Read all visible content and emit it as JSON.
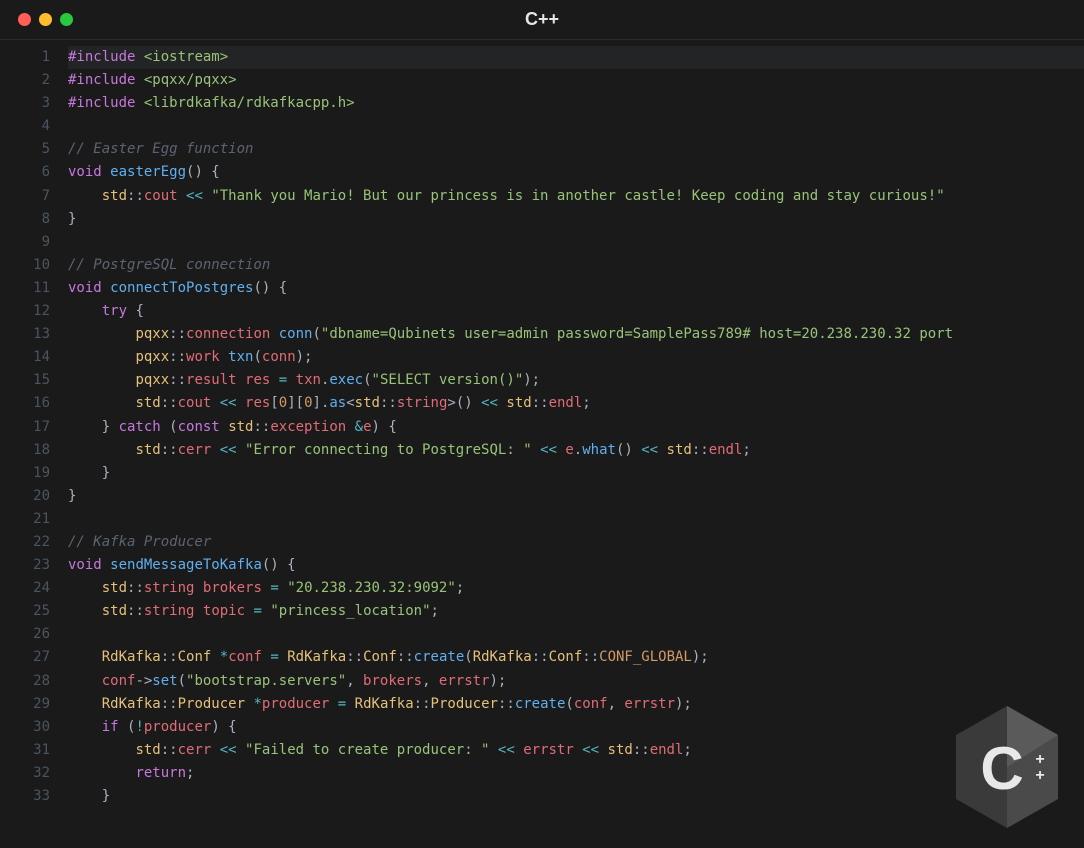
{
  "window": {
    "title": "C++"
  },
  "logo": {
    "letter": "C",
    "suffix": "++"
  },
  "code": {
    "lines": [
      {
        "n": 1,
        "hl": true,
        "seg": [
          {
            "c": "pp",
            "t": "#include"
          },
          {
            "c": "pun",
            "t": " "
          },
          {
            "c": "inc",
            "t": "<iostream>"
          }
        ]
      },
      {
        "n": 2,
        "seg": [
          {
            "c": "pp",
            "t": "#include"
          },
          {
            "c": "pun",
            "t": " "
          },
          {
            "c": "inc",
            "t": "<pqxx/pqxx>"
          }
        ]
      },
      {
        "n": 3,
        "seg": [
          {
            "c": "pp",
            "t": "#include"
          },
          {
            "c": "pun",
            "t": " "
          },
          {
            "c": "inc",
            "t": "<librdkafka/rdkafkacpp.h>"
          }
        ]
      },
      {
        "n": 4,
        "seg": []
      },
      {
        "n": 5,
        "seg": [
          {
            "c": "cmt",
            "t": "// Easter Egg function"
          }
        ]
      },
      {
        "n": 6,
        "seg": [
          {
            "c": "typ",
            "t": "void"
          },
          {
            "c": "pun",
            "t": " "
          },
          {
            "c": "fn",
            "t": "easterEgg"
          },
          {
            "c": "pun",
            "t": "() {"
          }
        ]
      },
      {
        "n": 7,
        "seg": [
          {
            "c": "pun",
            "t": "    "
          },
          {
            "c": "ns",
            "t": "std"
          },
          {
            "c": "pun",
            "t": "::"
          },
          {
            "c": "var",
            "t": "cout"
          },
          {
            "c": "pun",
            "t": " "
          },
          {
            "c": "op",
            "t": "<<"
          },
          {
            "c": "pun",
            "t": " "
          },
          {
            "c": "str",
            "t": "\"Thank you Mario! But our princess is in another castle! Keep coding and stay curious!\""
          }
        ]
      },
      {
        "n": 8,
        "seg": [
          {
            "c": "pun",
            "t": "}"
          }
        ]
      },
      {
        "n": 9,
        "seg": []
      },
      {
        "n": 10,
        "seg": [
          {
            "c": "cmt",
            "t": "// PostgreSQL connection"
          }
        ]
      },
      {
        "n": 11,
        "seg": [
          {
            "c": "typ",
            "t": "void"
          },
          {
            "c": "pun",
            "t": " "
          },
          {
            "c": "fn",
            "t": "connectToPostgres"
          },
          {
            "c": "pun",
            "t": "() {"
          }
        ]
      },
      {
        "n": 12,
        "seg": [
          {
            "c": "pun",
            "t": "    "
          },
          {
            "c": "kw",
            "t": "try"
          },
          {
            "c": "pun",
            "t": " {"
          }
        ]
      },
      {
        "n": 13,
        "seg": [
          {
            "c": "pun",
            "t": "        "
          },
          {
            "c": "ns",
            "t": "pqxx"
          },
          {
            "c": "pun",
            "t": "::"
          },
          {
            "c": "var",
            "t": "connection"
          },
          {
            "c": "pun",
            "t": " "
          },
          {
            "c": "fn",
            "t": "conn"
          },
          {
            "c": "pun",
            "t": "("
          },
          {
            "c": "str",
            "t": "\"dbname=Qubinets user=admin password=SamplePass789# host=20.238.230.32 port"
          }
        ]
      },
      {
        "n": 14,
        "seg": [
          {
            "c": "pun",
            "t": "        "
          },
          {
            "c": "ns",
            "t": "pqxx"
          },
          {
            "c": "pun",
            "t": "::"
          },
          {
            "c": "var",
            "t": "work"
          },
          {
            "c": "pun",
            "t": " "
          },
          {
            "c": "fn",
            "t": "txn"
          },
          {
            "c": "pun",
            "t": "("
          },
          {
            "c": "var",
            "t": "conn"
          },
          {
            "c": "pun",
            "t": ");"
          }
        ]
      },
      {
        "n": 15,
        "seg": [
          {
            "c": "pun",
            "t": "        "
          },
          {
            "c": "ns",
            "t": "pqxx"
          },
          {
            "c": "pun",
            "t": "::"
          },
          {
            "c": "var",
            "t": "result"
          },
          {
            "c": "pun",
            "t": " "
          },
          {
            "c": "var",
            "t": "res"
          },
          {
            "c": "pun",
            "t": " "
          },
          {
            "c": "op",
            "t": "="
          },
          {
            "c": "pun",
            "t": " "
          },
          {
            "c": "var",
            "t": "txn"
          },
          {
            "c": "pun",
            "t": "."
          },
          {
            "c": "mem",
            "t": "exec"
          },
          {
            "c": "pun",
            "t": "("
          },
          {
            "c": "str",
            "t": "\"SELECT version()\""
          },
          {
            "c": "pun",
            "t": ");"
          }
        ]
      },
      {
        "n": 16,
        "seg": [
          {
            "c": "pun",
            "t": "        "
          },
          {
            "c": "ns",
            "t": "std"
          },
          {
            "c": "pun",
            "t": "::"
          },
          {
            "c": "var",
            "t": "cout"
          },
          {
            "c": "pun",
            "t": " "
          },
          {
            "c": "op",
            "t": "<<"
          },
          {
            "c": "pun",
            "t": " "
          },
          {
            "c": "var",
            "t": "res"
          },
          {
            "c": "pun",
            "t": "["
          },
          {
            "c": "num",
            "t": "0"
          },
          {
            "c": "pun",
            "t": "]["
          },
          {
            "c": "num",
            "t": "0"
          },
          {
            "c": "pun",
            "t": "]."
          },
          {
            "c": "mem",
            "t": "as"
          },
          {
            "c": "pun",
            "t": "<"
          },
          {
            "c": "ns",
            "t": "std"
          },
          {
            "c": "pun",
            "t": "::"
          },
          {
            "c": "var",
            "t": "string"
          },
          {
            "c": "pun",
            "t": ">() "
          },
          {
            "c": "op",
            "t": "<<"
          },
          {
            "c": "pun",
            "t": " "
          },
          {
            "c": "ns",
            "t": "std"
          },
          {
            "c": "pun",
            "t": "::"
          },
          {
            "c": "var",
            "t": "endl"
          },
          {
            "c": "pun",
            "t": ";"
          }
        ]
      },
      {
        "n": 17,
        "seg": [
          {
            "c": "pun",
            "t": "    } "
          },
          {
            "c": "kw",
            "t": "catch"
          },
          {
            "c": "pun",
            "t": " ("
          },
          {
            "c": "typ",
            "t": "const"
          },
          {
            "c": "pun",
            "t": " "
          },
          {
            "c": "ns",
            "t": "std"
          },
          {
            "c": "pun",
            "t": "::"
          },
          {
            "c": "var",
            "t": "exception"
          },
          {
            "c": "pun",
            "t": " "
          },
          {
            "c": "op",
            "t": "&"
          },
          {
            "c": "var",
            "t": "e"
          },
          {
            "c": "pun",
            "t": ") {"
          }
        ]
      },
      {
        "n": 18,
        "seg": [
          {
            "c": "pun",
            "t": "        "
          },
          {
            "c": "ns",
            "t": "std"
          },
          {
            "c": "pun",
            "t": "::"
          },
          {
            "c": "var",
            "t": "cerr"
          },
          {
            "c": "pun",
            "t": " "
          },
          {
            "c": "op",
            "t": "<<"
          },
          {
            "c": "pun",
            "t": " "
          },
          {
            "c": "str",
            "t": "\"Error connecting to PostgreSQL: \""
          },
          {
            "c": "pun",
            "t": " "
          },
          {
            "c": "op",
            "t": "<<"
          },
          {
            "c": "pun",
            "t": " "
          },
          {
            "c": "var",
            "t": "e"
          },
          {
            "c": "pun",
            "t": "."
          },
          {
            "c": "mem",
            "t": "what"
          },
          {
            "c": "pun",
            "t": "() "
          },
          {
            "c": "op",
            "t": "<<"
          },
          {
            "c": "pun",
            "t": " "
          },
          {
            "c": "ns",
            "t": "std"
          },
          {
            "c": "pun",
            "t": "::"
          },
          {
            "c": "var",
            "t": "endl"
          },
          {
            "c": "pun",
            "t": ";"
          }
        ]
      },
      {
        "n": 19,
        "seg": [
          {
            "c": "pun",
            "t": "    }"
          }
        ]
      },
      {
        "n": 20,
        "seg": [
          {
            "c": "pun",
            "t": "}"
          }
        ]
      },
      {
        "n": 21,
        "seg": []
      },
      {
        "n": 22,
        "seg": [
          {
            "c": "cmt",
            "t": "// Kafka Producer"
          }
        ]
      },
      {
        "n": 23,
        "seg": [
          {
            "c": "typ",
            "t": "void"
          },
          {
            "c": "pun",
            "t": " "
          },
          {
            "c": "fn",
            "t": "sendMessageToKafka"
          },
          {
            "c": "pun",
            "t": "() {"
          }
        ]
      },
      {
        "n": 24,
        "seg": [
          {
            "c": "pun",
            "t": "    "
          },
          {
            "c": "ns",
            "t": "std"
          },
          {
            "c": "pun",
            "t": "::"
          },
          {
            "c": "var",
            "t": "string"
          },
          {
            "c": "pun",
            "t": " "
          },
          {
            "c": "var",
            "t": "brokers"
          },
          {
            "c": "pun",
            "t": " "
          },
          {
            "c": "op",
            "t": "="
          },
          {
            "c": "pun",
            "t": " "
          },
          {
            "c": "str",
            "t": "\"20.238.230.32:9092\""
          },
          {
            "c": "pun",
            "t": ";"
          }
        ]
      },
      {
        "n": 25,
        "seg": [
          {
            "c": "pun",
            "t": "    "
          },
          {
            "c": "ns",
            "t": "std"
          },
          {
            "c": "pun",
            "t": "::"
          },
          {
            "c": "var",
            "t": "string"
          },
          {
            "c": "pun",
            "t": " "
          },
          {
            "c": "var",
            "t": "topic"
          },
          {
            "c": "pun",
            "t": " "
          },
          {
            "c": "op",
            "t": "="
          },
          {
            "c": "pun",
            "t": " "
          },
          {
            "c": "str",
            "t": "\"princess_location\""
          },
          {
            "c": "pun",
            "t": ";"
          }
        ]
      },
      {
        "n": 26,
        "seg": []
      },
      {
        "n": 27,
        "seg": [
          {
            "c": "pun",
            "t": "    "
          },
          {
            "c": "ns",
            "t": "RdKafka"
          },
          {
            "c": "pun",
            "t": "::"
          },
          {
            "c": "ns",
            "t": "Conf"
          },
          {
            "c": "pun",
            "t": " "
          },
          {
            "c": "op",
            "t": "*"
          },
          {
            "c": "var",
            "t": "conf"
          },
          {
            "c": "pun",
            "t": " "
          },
          {
            "c": "op",
            "t": "="
          },
          {
            "c": "pun",
            "t": " "
          },
          {
            "c": "ns",
            "t": "RdKafka"
          },
          {
            "c": "pun",
            "t": "::"
          },
          {
            "c": "ns",
            "t": "Conf"
          },
          {
            "c": "pun",
            "t": "::"
          },
          {
            "c": "mem",
            "t": "create"
          },
          {
            "c": "pun",
            "t": "("
          },
          {
            "c": "ns",
            "t": "RdKafka"
          },
          {
            "c": "pun",
            "t": "::"
          },
          {
            "c": "ns",
            "t": "Conf"
          },
          {
            "c": "pun",
            "t": "::"
          },
          {
            "c": "con",
            "t": "CONF_GLOBAL"
          },
          {
            "c": "pun",
            "t": ");"
          }
        ]
      },
      {
        "n": 28,
        "seg": [
          {
            "c": "pun",
            "t": "    "
          },
          {
            "c": "var",
            "t": "conf"
          },
          {
            "c": "pun",
            "t": "->"
          },
          {
            "c": "mem",
            "t": "set"
          },
          {
            "c": "pun",
            "t": "("
          },
          {
            "c": "str",
            "t": "\"bootstrap.servers\""
          },
          {
            "c": "pun",
            "t": ", "
          },
          {
            "c": "var",
            "t": "brokers"
          },
          {
            "c": "pun",
            "t": ", "
          },
          {
            "c": "var",
            "t": "errstr"
          },
          {
            "c": "pun",
            "t": ");"
          }
        ]
      },
      {
        "n": 29,
        "seg": [
          {
            "c": "pun",
            "t": "    "
          },
          {
            "c": "ns",
            "t": "RdKafka"
          },
          {
            "c": "pun",
            "t": "::"
          },
          {
            "c": "ns",
            "t": "Producer"
          },
          {
            "c": "pun",
            "t": " "
          },
          {
            "c": "op",
            "t": "*"
          },
          {
            "c": "var",
            "t": "producer"
          },
          {
            "c": "pun",
            "t": " "
          },
          {
            "c": "op",
            "t": "="
          },
          {
            "c": "pun",
            "t": " "
          },
          {
            "c": "ns",
            "t": "RdKafka"
          },
          {
            "c": "pun",
            "t": "::"
          },
          {
            "c": "ns",
            "t": "Producer"
          },
          {
            "c": "pun",
            "t": "::"
          },
          {
            "c": "mem",
            "t": "create"
          },
          {
            "c": "pun",
            "t": "("
          },
          {
            "c": "var",
            "t": "conf"
          },
          {
            "c": "pun",
            "t": ", "
          },
          {
            "c": "var",
            "t": "errstr"
          },
          {
            "c": "pun",
            "t": ");"
          }
        ]
      },
      {
        "n": 30,
        "seg": [
          {
            "c": "pun",
            "t": "    "
          },
          {
            "c": "kw",
            "t": "if"
          },
          {
            "c": "pun",
            "t": " ("
          },
          {
            "c": "op",
            "t": "!"
          },
          {
            "c": "var",
            "t": "producer"
          },
          {
            "c": "pun",
            "t": ") {"
          }
        ]
      },
      {
        "n": 31,
        "seg": [
          {
            "c": "pun",
            "t": "        "
          },
          {
            "c": "ns",
            "t": "std"
          },
          {
            "c": "pun",
            "t": "::"
          },
          {
            "c": "var",
            "t": "cerr"
          },
          {
            "c": "pun",
            "t": " "
          },
          {
            "c": "op",
            "t": "<<"
          },
          {
            "c": "pun",
            "t": " "
          },
          {
            "c": "str",
            "t": "\"Failed to create producer: \""
          },
          {
            "c": "pun",
            "t": " "
          },
          {
            "c": "op",
            "t": "<<"
          },
          {
            "c": "pun",
            "t": " "
          },
          {
            "c": "var",
            "t": "errstr"
          },
          {
            "c": "pun",
            "t": " "
          },
          {
            "c": "op",
            "t": "<<"
          },
          {
            "c": "pun",
            "t": " "
          },
          {
            "c": "ns",
            "t": "std"
          },
          {
            "c": "pun",
            "t": "::"
          },
          {
            "c": "var",
            "t": "endl"
          },
          {
            "c": "pun",
            "t": ";"
          }
        ]
      },
      {
        "n": 32,
        "seg": [
          {
            "c": "pun",
            "t": "        "
          },
          {
            "c": "kw",
            "t": "return"
          },
          {
            "c": "pun",
            "t": ";"
          }
        ]
      },
      {
        "n": 33,
        "seg": [
          {
            "c": "pun",
            "t": "    }"
          }
        ]
      }
    ]
  }
}
